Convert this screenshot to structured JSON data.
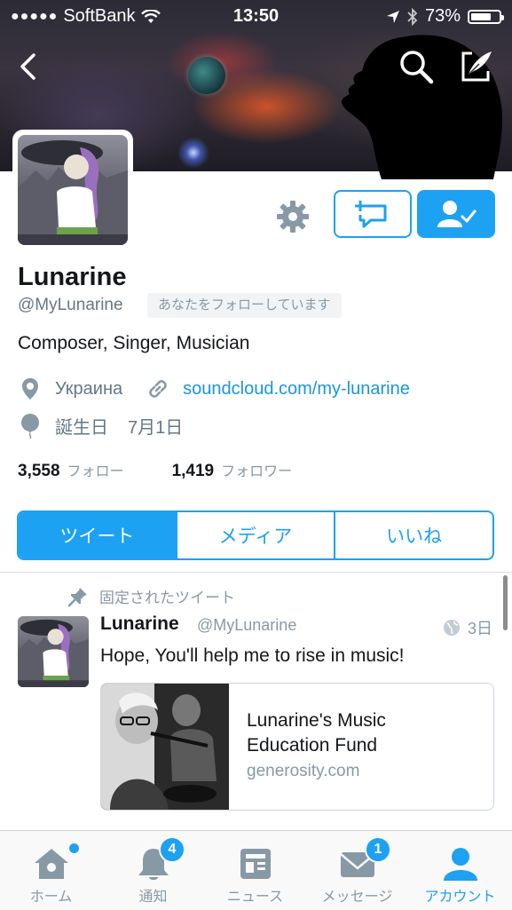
{
  "status_bar": {
    "signal_dots": "●●●●●",
    "carrier": "SoftBank",
    "time": "13:50",
    "battery": "73%",
    "battery_level": 0.73
  },
  "header": {
    "back_icon": "chevron-left-icon",
    "search_icon": "search-icon",
    "compose_icon": "compose-icon"
  },
  "profile": {
    "name": "Lunarine",
    "handle": "@MyLunarine",
    "follows_you": "あなたをフォローしています",
    "bio": "Composer, Singer, Musician",
    "location": "Украина",
    "website": "soundcloud.com/my-lunarine",
    "birthday_label": "誕生日",
    "birthday_value": "7月1日",
    "following_count": "3,558",
    "following_label": "フォロー",
    "followers_count": "1,419",
    "followers_label": "フォロワー"
  },
  "tabs": [
    {
      "label": "ツイート",
      "active": true
    },
    {
      "label": "メディア",
      "active": false
    },
    {
      "label": "いいね",
      "active": false
    }
  ],
  "pinned_tweet": {
    "pinned_label": "固定されたツイート",
    "author_name": "Lunarine",
    "author_handle": "@MyLunarine",
    "time": "3日",
    "text": "Hope, You'll help me to rise in music!",
    "card_title": "Lunarine's Music Education Fund",
    "card_domain": "generosity.com"
  },
  "tab_bar": {
    "items": [
      {
        "label": "ホーム",
        "icon": "home-icon",
        "badge": "",
        "active": false
      },
      {
        "label": "通知",
        "icon": "bell-icon",
        "badge": "4",
        "active": false
      },
      {
        "label": "ニュース",
        "icon": "news-icon",
        "badge": "",
        "active": false
      },
      {
        "label": "メッセージ",
        "icon": "envelope-icon",
        "badge": "1",
        "active": false
      },
      {
        "label": "アカウント",
        "icon": "person-icon",
        "badge": "",
        "active": true
      }
    ]
  },
  "colors": {
    "accent": "#1da1f2",
    "muted": "#8899a6",
    "text": "#14171a"
  }
}
